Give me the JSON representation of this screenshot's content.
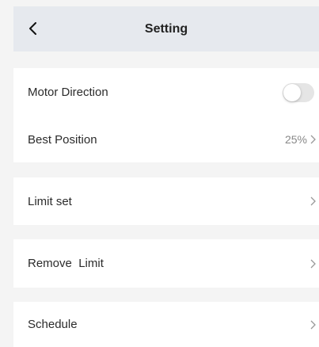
{
  "header": {
    "title": "Setting",
    "back_icon": "chevron-left-icon"
  },
  "settings": {
    "motor_direction": {
      "label": "Motor Direction",
      "toggle_on": false
    },
    "best_position": {
      "label": "Best Position",
      "value": "25%"
    },
    "limit_set": {
      "label": "Limit set"
    },
    "remove_limit": {
      "label": "Remove  Limit"
    },
    "schedule": {
      "label": "Schedule"
    }
  },
  "colors": {
    "header_bg": "#e6e9ee",
    "page_bg": "#f4f4f4",
    "row_bg": "#ffffff",
    "toggle_off": "#e5e5e5"
  }
}
